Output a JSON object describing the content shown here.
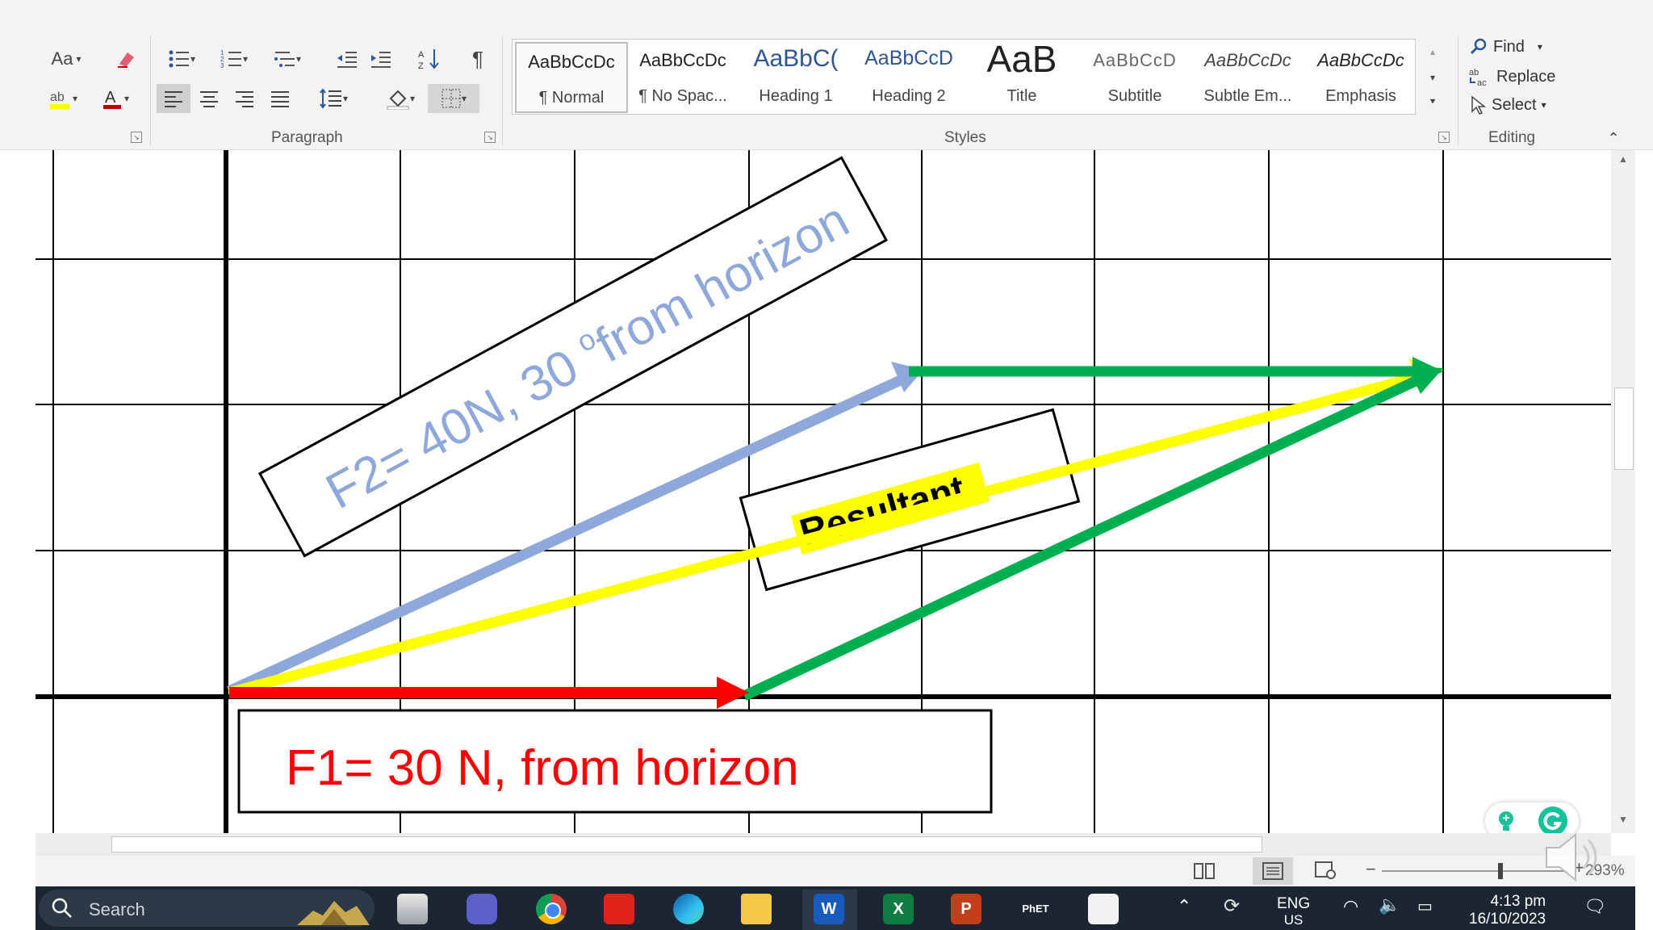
{
  "ribbon": {
    "font": {
      "change_case": "Aa"
    },
    "paragraph": {
      "label": "Paragraph"
    },
    "styles": {
      "label": "Styles",
      "items": [
        {
          "preview": "AaBbCcDc",
          "name": "¶ Normal"
        },
        {
          "preview": "AaBbCcDc",
          "name": "¶ No Spac..."
        },
        {
          "preview": "AaBbC(",
          "name": "Heading 1"
        },
        {
          "preview": "AaBbCcD",
          "name": "Heading 2"
        },
        {
          "preview": "AaB",
          "name": "Title"
        },
        {
          "preview": "AaBbCcD",
          "name": "Subtitle"
        },
        {
          "preview": "AaBbCcDc",
          "name": "Subtle Em..."
        },
        {
          "preview": "AaBbCcDc",
          "name": "Emphasis"
        }
      ]
    },
    "editing": {
      "label": "Editing",
      "find": "Find",
      "replace": "Replace",
      "select": "Select"
    }
  },
  "document": {
    "f2_label": "F2= 40N, 30 ",
    "f2_degree": "o",
    "f2_label_end": "from horizon",
    "resultant_label": "Resultant",
    "f1_label": "F1= 30 N, from horizon",
    "colors": {
      "f1": "#ff0000",
      "f2": "#8fa8dc",
      "resultant": "#ffff00",
      "green": "#00b050",
      "highlight": "#ffff00",
      "f2_text": "#8fa8dc",
      "f1_text": "#ff0000"
    }
  },
  "status": {
    "zoom": "293%"
  },
  "taskbar": {
    "search_placeholder": "Search",
    "apps": [
      "file-explorer-icon",
      "teams-icon",
      "chrome-icon",
      "pdf-icon",
      "edge-icon",
      "folder-icon",
      "word-icon",
      "excel-icon",
      "powerpoint-icon",
      "phet-icon",
      "paint-icon"
    ],
    "phet_label": "PhET",
    "lang_primary": "ENG",
    "lang_secondary": "US",
    "time": "4:13 pm",
    "date": "16/10/2023"
  }
}
